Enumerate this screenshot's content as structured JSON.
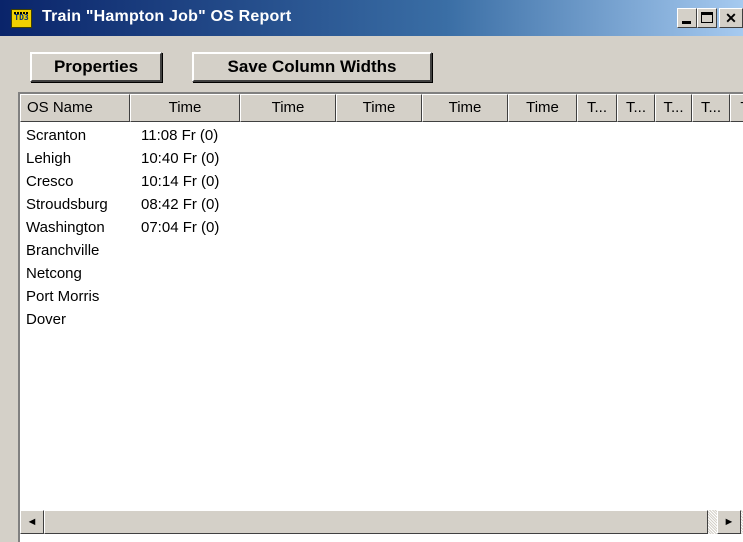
{
  "window": {
    "title": "Train \"Hampton Job\" OS Report",
    "icon_label": "TD3",
    "icon": "td3-app-icon",
    "controls": {
      "minimize": "minimize-icon",
      "maximize": "maximize-icon",
      "close": "close-icon",
      "close_glyph": "✕"
    }
  },
  "toolbar": {
    "properties_label": "Properties",
    "save_widths_label": "Save Column Widths"
  },
  "table": {
    "headers": [
      "OS Name",
      "Time",
      "Time",
      "Time",
      "Time",
      "Time",
      "T...",
      "T...",
      "T...",
      "T...",
      "T"
    ],
    "rows": [
      [
        "Scranton",
        "11:08 Fr (0)"
      ],
      [
        "Lehigh",
        "10:40 Fr (0)"
      ],
      [
        "Cresco",
        "10:14 Fr (0)"
      ],
      [
        "Stroudsburg",
        "08:42 Fr (0)"
      ],
      [
        "Washington",
        "07:04 Fr (0)"
      ],
      [
        "Branchville",
        ""
      ],
      [
        "Netcong",
        ""
      ],
      [
        "Port Morris",
        ""
      ],
      [
        "Dover",
        ""
      ]
    ]
  },
  "scrollbar": {
    "left_arrow": "◄",
    "right_arrow": "►"
  },
  "colors": {
    "titlebar_start": "#0a246a",
    "titlebar_end": "#a6caf0",
    "face": "#d4d0c8"
  }
}
